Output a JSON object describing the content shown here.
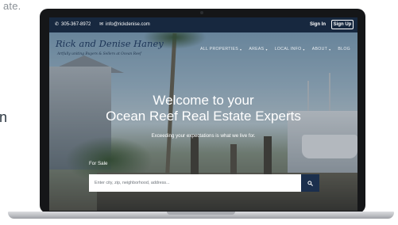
{
  "fragments": {
    "top": "ate.",
    "left": "n"
  },
  "topbar": {
    "phone": "305-367-8972",
    "email": "info@rickdenise.com",
    "sign_in": "Sign In",
    "sign_up": "Sign Up",
    "icons": [
      "phone-icon",
      "mail-icon"
    ]
  },
  "header": {
    "logo_title": "Rick and Denise Haney",
    "logo_tagline": "Artfully uniting Buyers & Sellers at Ocean Reef",
    "nav": [
      {
        "label": "ALL PROPERTIES",
        "caret": "▾"
      },
      {
        "label": "AREAS",
        "caret": "▾"
      },
      {
        "label": "LOCAL INFO",
        "caret": "▾"
      },
      {
        "label": "ABOUT",
        "caret": "▾"
      },
      {
        "label": "BLOG",
        "caret": ""
      }
    ]
  },
  "hero": {
    "line1": "Welcome to your",
    "line2": "Ocean Reef Real Estate Experts",
    "subtitle": "Exceeding your expectations is what we live for."
  },
  "search": {
    "tab": "For Sale",
    "placeholder": "Enter city, zip, neighborhood, address...",
    "button_icon": "search-icon"
  },
  "colors": {
    "topbar": "#17283f",
    "search_button": "#1b2f4d",
    "logo": "#1d3557"
  }
}
